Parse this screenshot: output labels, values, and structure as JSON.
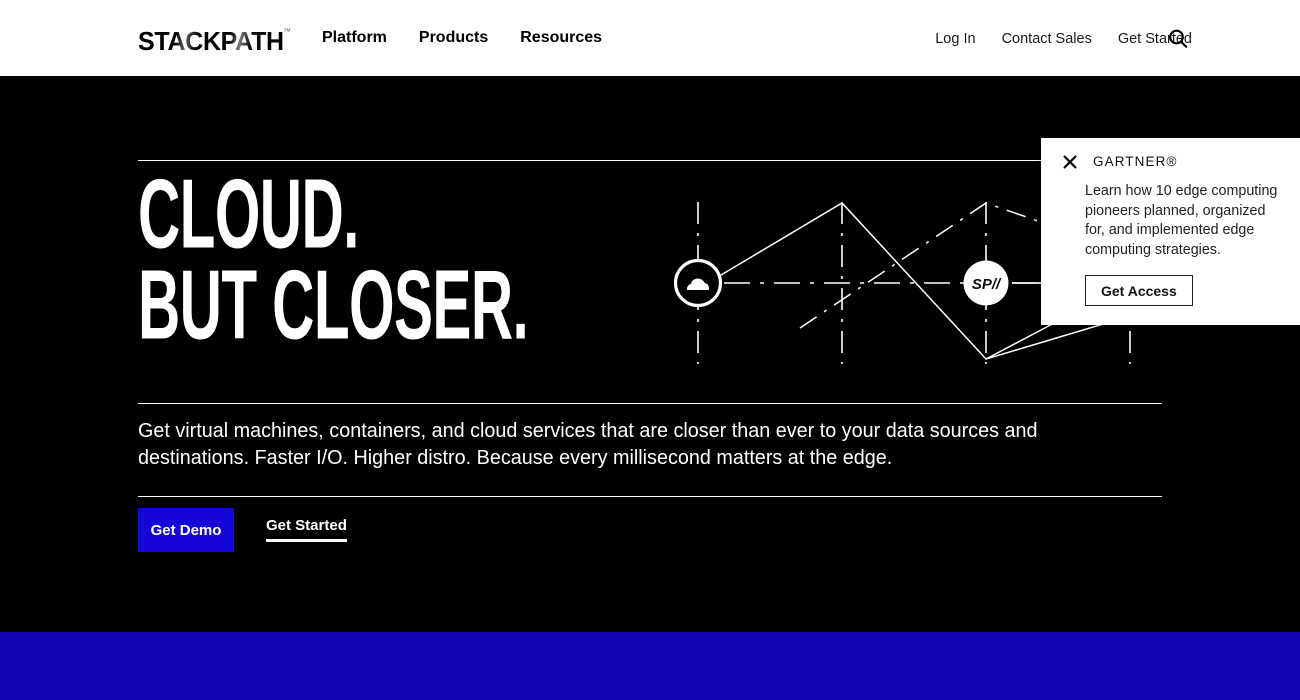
{
  "brand": {
    "logo_text": "STACKPATH",
    "logo_tm": "™",
    "accent_button": "#1505d8",
    "accent_band": "#1005b5",
    "hero_background": "#000000"
  },
  "header": {
    "nav_main": [
      {
        "label": "Platform",
        "name": "nav-platform"
      },
      {
        "label": "Products",
        "name": "nav-products"
      },
      {
        "label": "Resources",
        "name": "nav-resources"
      }
    ],
    "nav_right": [
      {
        "label": "Log In",
        "name": "nav-log-in"
      },
      {
        "label": "Contact Sales",
        "name": "nav-contact-sales"
      },
      {
        "label": "Get Started",
        "name": "nav-get-started"
      }
    ],
    "search_icon": "search-icon"
  },
  "hero": {
    "headline_line1": "CLOUD.",
    "headline_line2": "BUT CLOSER.",
    "subcopy": "Get virtual machines, containers, and cloud services that are closer than ever to your data sources and destinations. Faster I/O. Higher distro. Because every millisecond matters at the edge.",
    "cta_primary": "Get Demo",
    "cta_secondary": "Get Started",
    "diagram": {
      "node_cloud_icon": "cloud-icon",
      "node_sp_label": "SP//"
    }
  },
  "gartner_card": {
    "title": "GARTNER®",
    "body": "Learn how 10 edge computing pioneers planned, organized for, and implemented edge computing strategies.",
    "cta": "Get Access",
    "close_icon": "close-icon"
  }
}
